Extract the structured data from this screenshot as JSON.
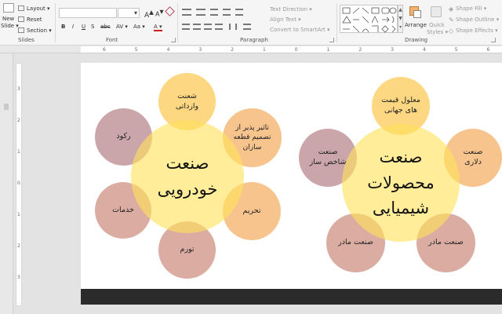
{
  "ribbon": {
    "slides_group": {
      "new_slide": [
        "New",
        "Slide ▾"
      ],
      "layout": "Layout ▾",
      "reset": "Reset",
      "section": "Section ▾",
      "label": "Slides"
    },
    "font_group": {
      "label": "Font",
      "buttons": [
        "B",
        "I",
        "U",
        "S",
        "abc",
        "AV ▾",
        "Aa ▾",
        "A ▾"
      ]
    },
    "paragraph_group": {
      "label": "Paragraph",
      "text_direction": "Text Direction ▾",
      "align_text": "Align Text ▾",
      "convert_smartart": "Convert to SmartArt ▾"
    },
    "drawing_group": {
      "label": "Drawing",
      "arrange": "Arrange",
      "quick_styles": [
        "Quick",
        "Styles ▾"
      ],
      "shape_fill": "Shape Fill ▾",
      "shape_outline": "Shape Outline ▾",
      "shape_effects": "Shape Effects ▾"
    }
  },
  "ruler": {
    "top_numbers": [
      "6",
      "5",
      "4",
      "3",
      "2",
      "1",
      "0",
      "1",
      "2",
      "3",
      "4",
      "5",
      "6"
    ],
    "left_numbers": [
      "3",
      "2",
      "1",
      "0",
      "1",
      "2",
      "3"
    ]
  },
  "diagram_left": {
    "center": [
      "صنعت",
      "خودرویی"
    ],
    "satellites": [
      [
        "شعنت",
        "وارداتی"
      ],
      [
        "تاثیر پذیر از",
        "تصمیم قطعه",
        "سازان"
      ],
      [
        "تحریم"
      ],
      [
        "تورم"
      ],
      [
        "خدمات"
      ],
      [
        "رکود"
      ]
    ]
  },
  "diagram_right": {
    "center": [
      "صنعت",
      "محصولات",
      "شیمیایی"
    ],
    "satellites": [
      [
        "معلول قیمت",
        "های جهانی"
      ],
      [
        "صنعت",
        "دلاری"
      ],
      [
        "صنعت مادر"
      ],
      [
        "صنعت مادر"
      ],
      [
        "صنعت",
        "شاخص ساز"
      ]
    ]
  },
  "colors": {
    "center": "#ffe25a",
    "yellow": "#fcc446",
    "orange": "#f4ad62",
    "rose": "#cd8e7e",
    "mauve": "#b58389"
  }
}
